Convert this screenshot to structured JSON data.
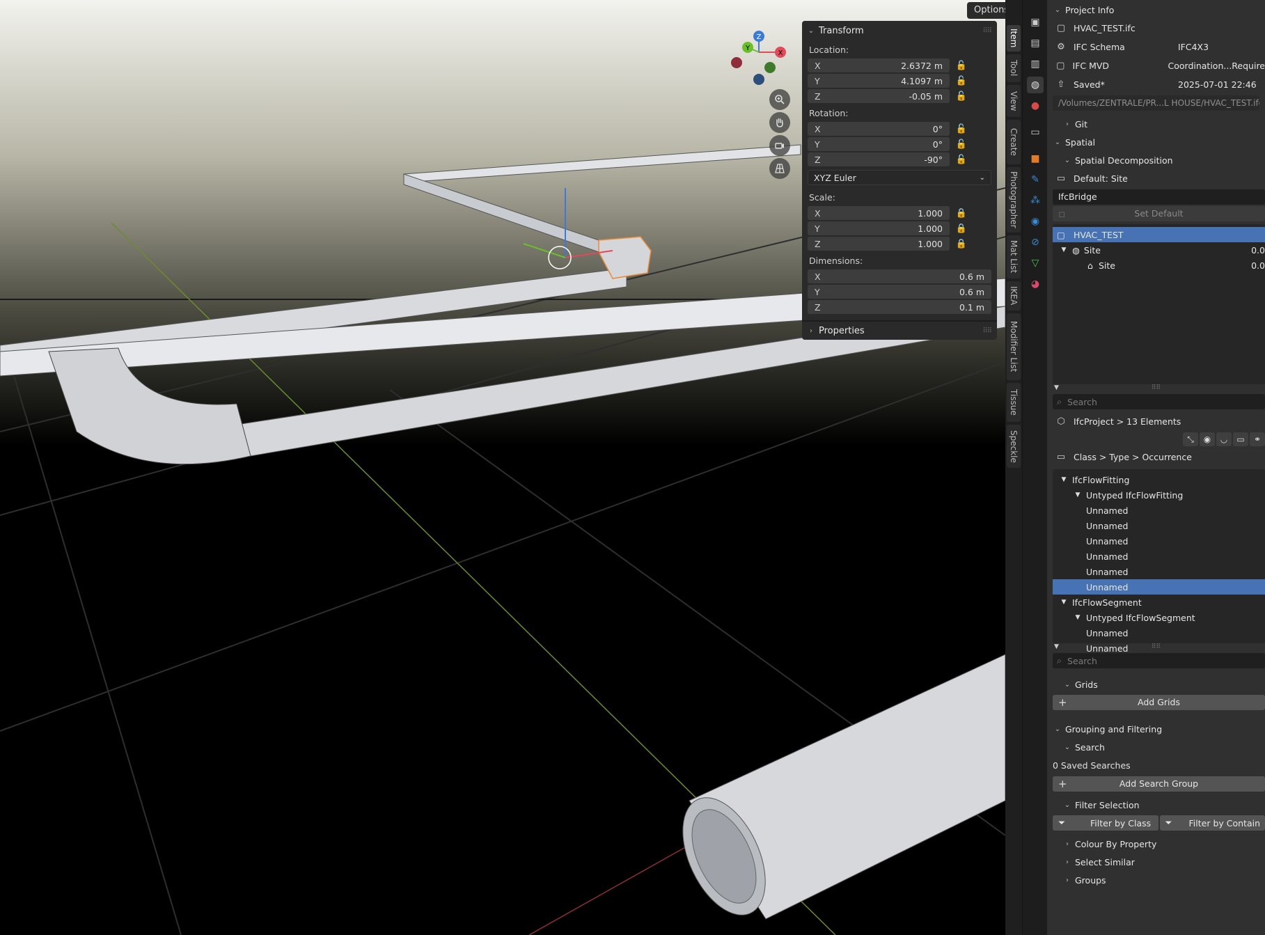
{
  "viewport": {
    "options_label": "Options",
    "gizmo": {
      "x": "X",
      "y": "Y",
      "z": "Z"
    }
  },
  "npanel": {
    "transform_title": "Transform",
    "location_label": "Location:",
    "location": [
      {
        "axis": "X",
        "value": "2.6372 m"
      },
      {
        "axis": "Y",
        "value": "4.1097 m"
      },
      {
        "axis": "Z",
        "value": "-0.05 m"
      }
    ],
    "rotation_label": "Rotation:",
    "rotation": [
      {
        "axis": "X",
        "value": "0°"
      },
      {
        "axis": "Y",
        "value": "0°"
      },
      {
        "axis": "Z",
        "value": "-90°"
      }
    ],
    "rotation_mode": "XYZ Euler",
    "scale_label": "Scale:",
    "scale": [
      {
        "axis": "X",
        "value": "1.000"
      },
      {
        "axis": "Y",
        "value": "1.000"
      },
      {
        "axis": "Z",
        "value": "1.000"
      }
    ],
    "dimensions_label": "Dimensions:",
    "dimensions": [
      {
        "axis": "X",
        "value": "0.6 m"
      },
      {
        "axis": "Y",
        "value": "0.6 m"
      },
      {
        "axis": "Z",
        "value": "0.1 m"
      }
    ],
    "properties_title": "Properties"
  },
  "tabs": [
    "Item",
    "Tool",
    "View",
    "Create",
    "Photographer",
    "Mat List",
    "IKEA",
    "Modifier List",
    "Tissue",
    "Speckle"
  ],
  "props": {
    "project_info": "Project Info",
    "file_name": "HVAC_TEST.ifc",
    "schema_key": "IFC Schema",
    "schema_val": "IFC4X3",
    "mvd_key": "IFC MVD",
    "mvd_val": "Coordination...Require",
    "saved_key": "Saved*",
    "saved_val": "2025-07-01 22:46",
    "path": "/Volumes/ZENTRALE/PR...L HOUSE/HVAC_TEST.ifc",
    "git": "Git",
    "spatial": "Spatial",
    "spatial_decomposition": "Spatial Decomposition",
    "default_site": "Default: Site",
    "container_type": "IfcBridge",
    "set_default": "Set Default",
    "tree_project": "HVAC_TEST",
    "tree_site": "Site",
    "tree_site2": "Site",
    "tree_site_val": "0.0",
    "tree_site2_val": "0.0",
    "search_placeholder": "Search",
    "elements_label": "IfcProject > 13 Elements",
    "grouping_label": "Class > Type > Occurrence",
    "classes": [
      {
        "name": "IfcFlowFitting",
        "type": "Untyped IfcFlowFitting",
        "items": [
          "Unnamed",
          "Unnamed",
          "Unnamed",
          "Unnamed",
          "Unnamed",
          "Unnamed"
        ],
        "selected": 5
      },
      {
        "name": "IfcFlowSegment",
        "type": "Untyped IfcFlowSegment",
        "items": [
          "Unnamed",
          "Unnamed"
        ],
        "selected": -1
      }
    ],
    "search_placeholder2": "Search",
    "grids": "Grids",
    "add_grids": "Add Grids",
    "grouping_filtering": "Grouping and Filtering",
    "search_section": "Search",
    "saved_searches": "0 Saved Searches",
    "add_search_group": "Add Search Group",
    "filter_selection": "Filter Selection",
    "filter_by_class": "Filter by Class",
    "filter_by_container": "Filter by Contain",
    "colour_by_property": "Colour By Property",
    "select_similar": "Select Similar",
    "groups": "Groups"
  }
}
